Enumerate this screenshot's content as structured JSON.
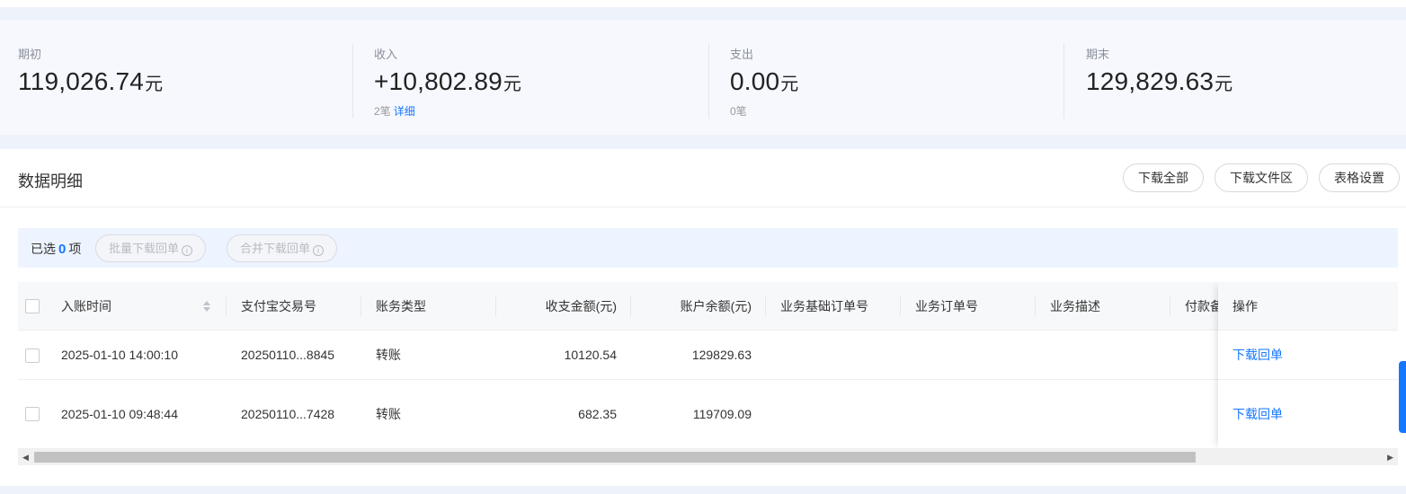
{
  "summary": {
    "opening": {
      "label": "期初",
      "value": "119,026.74",
      "unit": "元"
    },
    "income": {
      "label": "收入",
      "value": "+10,802.89",
      "unit": "元",
      "count": "2笔",
      "detail_link": "详细"
    },
    "expense": {
      "label": "支出",
      "value": "0.00",
      "unit": "元",
      "count": "0笔"
    },
    "closing": {
      "label": "期末",
      "value": "129,829.63",
      "unit": "元"
    }
  },
  "panel": {
    "title": "数据明细",
    "buttons": {
      "download_all": "下载全部",
      "download_area": "下载文件区",
      "table_settings": "表格设置"
    }
  },
  "selection": {
    "prefix": "已选",
    "count": "0",
    "suffix": "项",
    "batch_download": "批量下载回单",
    "merge_download": "合并下载回单",
    "info_glyph": "i"
  },
  "table": {
    "headers": {
      "time": "入账时间",
      "alipay_no": "支付宝交易号",
      "type": "账务类型",
      "amount": "收支金额(元)",
      "balance": "账户余额(元)",
      "base_order": "业务基础订单号",
      "order": "业务订单号",
      "desc": "业务描述",
      "remark": "付款备",
      "action": "操作"
    },
    "rows": [
      {
        "time": "2025-01-10 14:00:10",
        "alipay_no": "20250110...8845",
        "type": "转账",
        "amount": "10120.54",
        "balance": "129829.63",
        "action": "下载回单"
      },
      {
        "time": "2025-01-10 09:48:44",
        "alipay_no": "20250110...7428",
        "type": "转账",
        "amount": "682.35",
        "balance": "119709.09",
        "action": "下载回单"
      }
    ]
  },
  "colors": {
    "accent": "#1677ff",
    "summary_bg": "#f6f8fe",
    "page_bg": "#eef2fa",
    "selbar_bg": "#edf3ff"
  },
  "icons": [
    "sort-icon",
    "info-icon",
    "checkbox",
    "scroll-left-arrow",
    "scroll-right-arrow"
  ]
}
